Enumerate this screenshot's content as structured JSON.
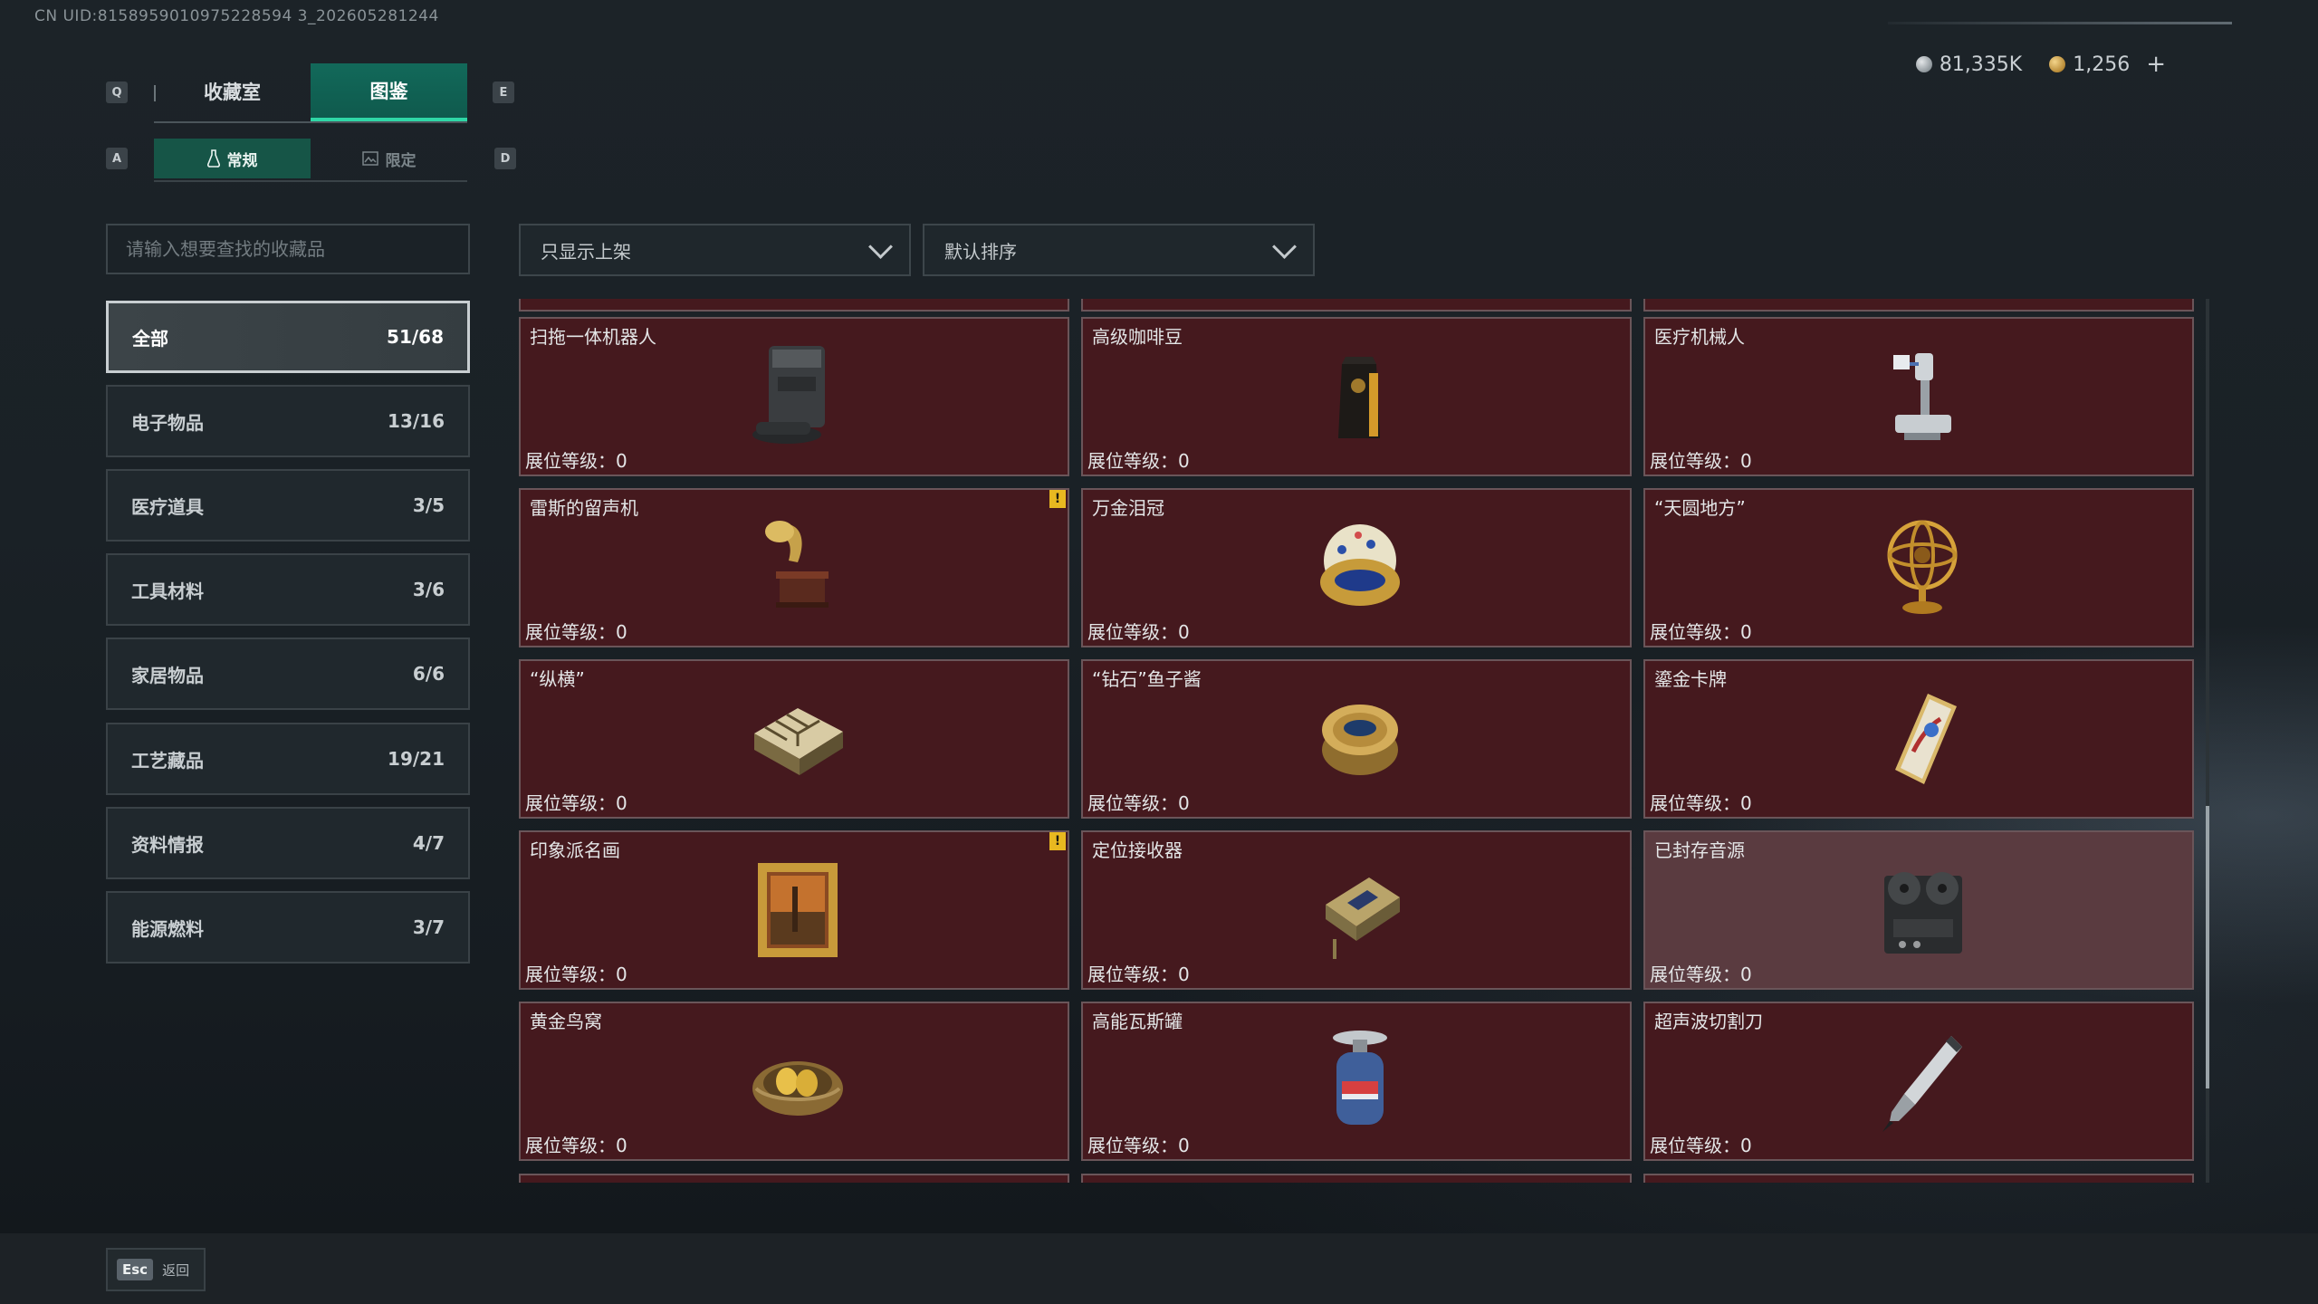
{
  "uid_text": "CN UID:8158959010975228594 3_202605281244",
  "currency": {
    "silver": "81,335K",
    "gold": "1,256",
    "plus": "+"
  },
  "keys": {
    "prev_tab": "Q",
    "next_tab": "E",
    "prev_sub": "A",
    "next_sub": "D"
  },
  "tabs": [
    {
      "label": "收藏室"
    },
    {
      "label": "图鉴"
    }
  ],
  "active_tab": "图鉴",
  "subtabs": [
    {
      "label": "常规"
    },
    {
      "label": "限定"
    }
  ],
  "search": {
    "placeholder": "请输入想要查找的收藏品",
    "value": ""
  },
  "filter": {
    "selected": "只显示上架"
  },
  "sort": {
    "selected": "默认排序"
  },
  "categories": [
    {
      "label": "全部",
      "count": "51/68",
      "active": true
    },
    {
      "label": "电子物品",
      "count": "13/16"
    },
    {
      "label": "医疗道具",
      "count": "3/5"
    },
    {
      "label": "工具材料",
      "count": "3/6"
    },
    {
      "label": "家居物品",
      "count": "6/6"
    },
    {
      "label": "工艺藏品",
      "count": "19/21"
    },
    {
      "label": "资料情报",
      "count": "4/7"
    },
    {
      "label": "能源燃料",
      "count": "3/7"
    }
  ],
  "level_label": "展位等级：",
  "items": [
    {
      "name": "扫拖一体机器人",
      "level": "0",
      "icon": "robot-vacuum-icon"
    },
    {
      "name": "高级咖啡豆",
      "level": "0",
      "icon": "coffee-bag-icon"
    },
    {
      "name": "医疗机械人",
      "level": "0",
      "icon": "medical-robot-icon"
    },
    {
      "name": "雷斯的留声机",
      "level": "0",
      "icon": "gramophone-icon",
      "warning": "!"
    },
    {
      "name": "万金泪冠",
      "level": "0",
      "icon": "jeweled-egg-icon"
    },
    {
      "name": "“天圆地方”",
      "level": "0",
      "icon": "armillary-sphere-icon"
    },
    {
      "name": "“纵横”",
      "level": "0",
      "icon": "chess-box-icon"
    },
    {
      "name": "“钻石”鱼子酱",
      "level": "0",
      "icon": "caviar-tin-icon"
    },
    {
      "name": "鎏金卡牌",
      "level": "0",
      "icon": "gold-card-icon"
    },
    {
      "name": "印象派名画",
      "level": "0",
      "icon": "framed-painting-icon",
      "warning": "!"
    },
    {
      "name": "定位接收器",
      "level": "0",
      "icon": "receiver-device-icon"
    },
    {
      "name": "已封存音源",
      "level": "0",
      "icon": "tape-recorder-icon",
      "dim": true
    },
    {
      "name": "黄金鸟窝",
      "level": "0",
      "icon": "golden-nest-icon"
    },
    {
      "name": "高能瓦斯罐",
      "level": "0",
      "icon": "gas-canister-icon"
    },
    {
      "name": "超声波切割刀",
      "level": "0",
      "icon": "ultrasonic-knife-icon"
    }
  ],
  "footer": {
    "key": "Esc",
    "label": "返回"
  }
}
